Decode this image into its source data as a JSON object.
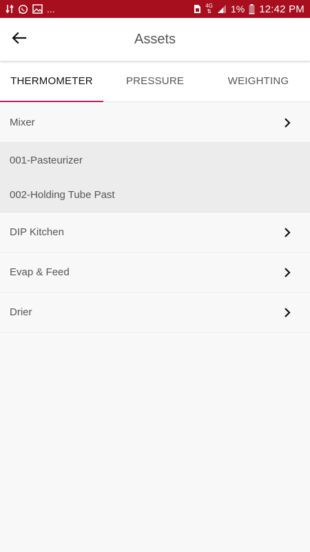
{
  "status_bar": {
    "left_icons": [
      "data-transfer-icon",
      "whatsapp-icon",
      "gallery-icon"
    ],
    "more": "...",
    "network": "4G",
    "battery_text": "1%",
    "time": "12:42 PM",
    "bar_color": "#a70e1e"
  },
  "app_bar": {
    "title": "Assets",
    "back_icon": "arrow-back-icon"
  },
  "tabs": [
    {
      "label": "THERMOMETER",
      "active": true
    },
    {
      "label": "PRESSURE",
      "active": false
    },
    {
      "label": "WEIGHTING",
      "active": false
    }
  ],
  "accent_color": "#c2185b",
  "list": {
    "mixer": {
      "label": "Mixer"
    },
    "mixer_children": [
      {
        "label": "001-Pasteurizer"
      },
      {
        "label": "002-Holding Tube Past"
      }
    ],
    "dip_kitchen": {
      "label": "DIP Kitchen"
    },
    "evap_feed": {
      "label": "Evap & Feed"
    },
    "drier": {
      "label": "Drier"
    }
  }
}
